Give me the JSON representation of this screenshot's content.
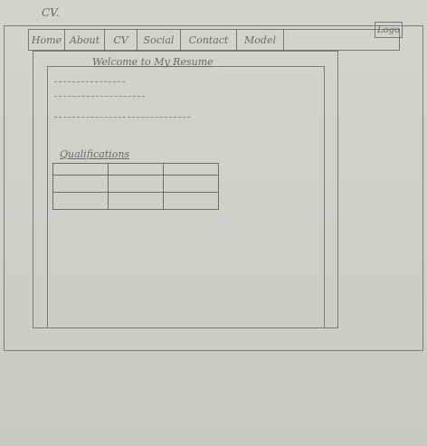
{
  "page_title": "CV.",
  "nav": {
    "items": [
      "Home",
      "About",
      "CV",
      "Social",
      "Contact",
      "Model"
    ]
  },
  "logo_label": "Logo",
  "welcome": "Welcome to My Resume",
  "qualifications": {
    "heading": "Qualifications",
    "rows": 3,
    "columns": 3
  }
}
